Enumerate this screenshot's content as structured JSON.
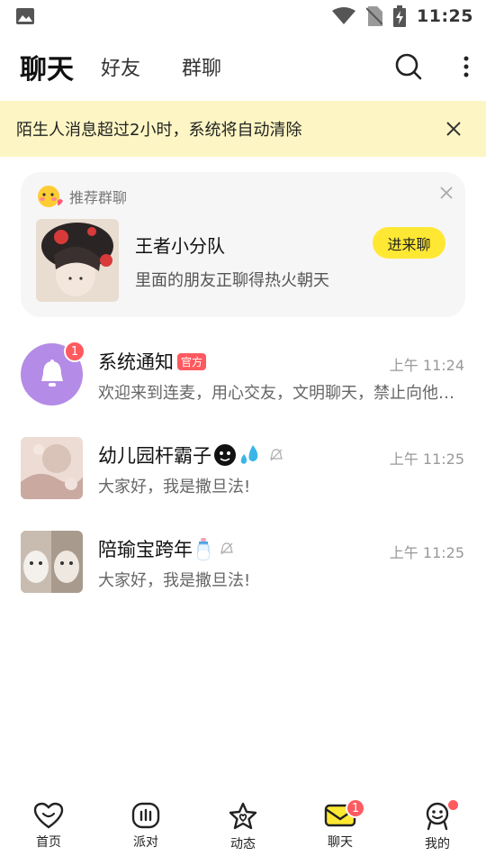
{
  "status_bar": {
    "time": "11:25"
  },
  "top_nav": {
    "tabs": [
      {
        "label": "聊天",
        "active": true
      },
      {
        "label": "好友",
        "active": false
      },
      {
        "label": "群聊",
        "active": false
      }
    ]
  },
  "notice": {
    "text": "陌生人消息超过2小时，系统将自动清除"
  },
  "recommend": {
    "header": "推荐群聊",
    "group_name": "王者小分队",
    "description": "里面的朋友正聊得热火朝天",
    "join_label": "进来聊"
  },
  "chats": [
    {
      "name": "系统通知",
      "tag": "官方",
      "time": "上午 11:24",
      "preview": "欢迎来到连麦，用心交友，文明聊天，禁止向他人索要联系方式",
      "unread": "1"
    },
    {
      "name": "幼儿园杆霸子",
      "time": "上午 11:25",
      "preview": "大家好，我是撒旦法!"
    },
    {
      "name": "陪瑜宝跨年",
      "time": "上午 11:25",
      "preview": "大家好，我是撒旦法!"
    }
  ],
  "bottom_nav": {
    "items": [
      {
        "label": "首页",
        "icon": "heart-icon"
      },
      {
        "label": "派对",
        "icon": "party-icon"
      },
      {
        "label": "动态",
        "icon": "star-icon"
      },
      {
        "label": "聊天",
        "icon": "chat-envelope-icon",
        "badge": "1",
        "active": true
      },
      {
        "label": "我的",
        "icon": "profile-icon"
      }
    ]
  },
  "colors": {
    "accent_yellow": "#ffe833",
    "notice_bg": "#fdf6c4",
    "badge_red": "#ff5a5f",
    "system_avatar": "#b48be6"
  }
}
